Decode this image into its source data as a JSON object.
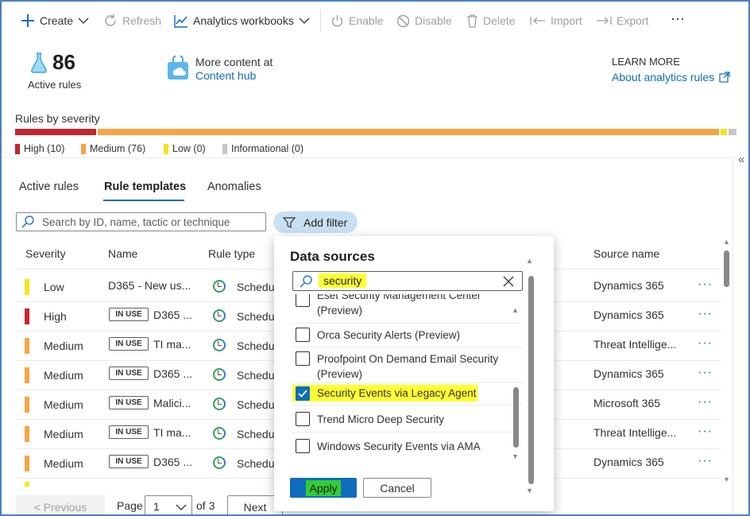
{
  "toolbar": {
    "create": "Create",
    "refresh": "Refresh",
    "analytics_workbooks": "Analytics workbooks",
    "enable": "Enable",
    "disable": "Disable",
    "delete": "Delete",
    "import": "Import",
    "export": "Export",
    "more": "···"
  },
  "summary": {
    "active_count": "86",
    "active_label": "Active rules",
    "content_hub_title": "More content at",
    "content_hub_link": "Content hub",
    "learn_more_title": "LEARN MORE",
    "learn_more_link": "About analytics rules"
  },
  "severity": {
    "title": "Rules by severity",
    "legend": [
      {
        "label": "High (10)",
        "color": "#c4262e"
      },
      {
        "label": "Medium (76)",
        "color": "#f7a544"
      },
      {
        "label": "Low (0)",
        "color": "#f5e51d"
      },
      {
        "label": "Informational (0)",
        "color": "#c8c6c4"
      }
    ]
  },
  "tabs": [
    "Active rules",
    "Rule templates",
    "Anomalies"
  ],
  "active_tab": "Rule templates",
  "search": {
    "placeholder": "Search by ID, name, tactic or technique"
  },
  "add_filter": "Add filter",
  "table": {
    "headers": {
      "severity": "Severity",
      "name": "Name",
      "rule_type": "Rule type",
      "source_name": "Source name"
    },
    "rows": [
      {
        "severity": "Low",
        "sev_color": "#f5e51d",
        "in_use": "",
        "name": "D365 - New us...",
        "type": "Schedu",
        "source": "Dynamics 365",
        "more": "···"
      },
      {
        "severity": "High",
        "sev_color": "#c4262e",
        "in_use": "IN USE",
        "name": "D365 ...",
        "type": "Schedu",
        "source": "Dynamics 365",
        "more": "···"
      },
      {
        "severity": "Medium",
        "sev_color": "#f7a544",
        "in_use": "IN USE",
        "name": "TI ma...",
        "type": "Schedu",
        "source": "Threat Intellige...",
        "more": "···"
      },
      {
        "severity": "Medium",
        "sev_color": "#f7a544",
        "in_use": "IN USE",
        "name": "D365 ...",
        "type": "Schedu",
        "source": "Dynamics 365",
        "more": "···"
      },
      {
        "severity": "Medium",
        "sev_color": "#f7a544",
        "in_use": "IN USE",
        "name": "Malici...",
        "type": "Schedu",
        "source": "Microsoft 365",
        "more": "···"
      },
      {
        "severity": "Medium",
        "sev_color": "#f7a544",
        "in_use": "IN USE",
        "name": "TI ma...",
        "type": "Schedu",
        "source": "Threat Intellige...",
        "more": "···"
      },
      {
        "severity": "Medium",
        "sev_color": "#f7a544",
        "in_use": "IN USE",
        "name": "D365 ...",
        "type": "Schedu",
        "source": "Dynamics 365",
        "more": "···"
      }
    ]
  },
  "pagination": {
    "previous": "< Previous",
    "page_label": "Page",
    "page_value": "1",
    "of_label": "of 3",
    "next": "Next"
  },
  "panel": {
    "title": "Data sources",
    "search_value": "security",
    "options": [
      {
        "label": "Eset Security Management Center (Preview)",
        "checked": false
      },
      {
        "label": "Orca Security Alerts (Preview)",
        "checked": false
      },
      {
        "label": "Proofpoint On Demand Email Security (Preview)",
        "checked": false
      },
      {
        "label": "Security Events via Legacy Agent",
        "checked": true
      },
      {
        "label": "Trend Micro Deep Security",
        "checked": false
      },
      {
        "label": "Windows Security Events via AMA",
        "checked": false
      }
    ],
    "apply": "Apply",
    "cancel": "Cancel"
  },
  "colors": {
    "accent": "#0f6cbd",
    "highlight": "#ffff33",
    "apply_highlight": "#33cc33"
  }
}
